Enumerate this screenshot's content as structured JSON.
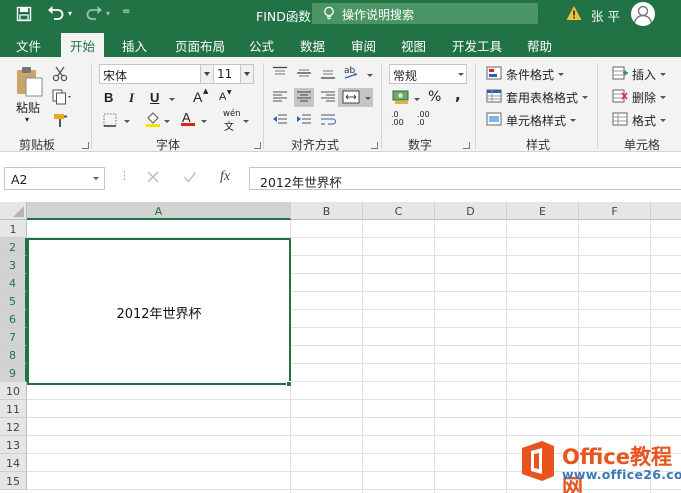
{
  "window": {
    "title": "FIND函数  -  Excel",
    "search_placeholder": "操作说明搜索",
    "user_name": "张平"
  },
  "tabs": [
    "文件",
    "开始",
    "插入",
    "页面布局",
    "公式",
    "数据",
    "审阅",
    "视图",
    "开发工具",
    "帮助"
  ],
  "active_tab": "开始",
  "ribbon": {
    "clipboard": {
      "label": "剪贴板",
      "paste": "粘贴"
    },
    "font": {
      "label": "字体",
      "name": "宋体",
      "size": "11",
      "bold": "B",
      "italic": "I",
      "underline": "U",
      "grow": "A",
      "shrink": "A",
      "wen": "wén"
    },
    "alignment": {
      "label": "对齐方式"
    },
    "number": {
      "label": "数字",
      "format": "常规",
      "percent": "%",
      "comma": ",",
      "inc_decimal": ".00",
      "dec_decimal": ".0"
    },
    "styles": {
      "label": "样式",
      "conditional": "条件格式",
      "table": "套用表格格式",
      "cell": "单元格样式"
    },
    "cells": {
      "label": "单元格",
      "insert": "插入",
      "delete": "删除",
      "format": "格式"
    }
  },
  "formula_bar": {
    "name_box": "A2",
    "content": "2012年世界杯"
  },
  "sheet": {
    "columns": [
      "A",
      "B",
      "C",
      "D",
      "E",
      "F"
    ],
    "rows": [
      "1",
      "2",
      "3",
      "4",
      "5",
      "6",
      "7",
      "8",
      "9",
      "10",
      "11",
      "12",
      "13",
      "14",
      "15"
    ],
    "merged_cell_text": "2012年世界杯"
  },
  "watermark": {
    "title": "Office教程网",
    "url": "www.office26.com"
  },
  "colors": {
    "excel_green": "#217346",
    "ribbon_bg": "#f3f3f3",
    "watermark_orange": "#e8541e"
  }
}
